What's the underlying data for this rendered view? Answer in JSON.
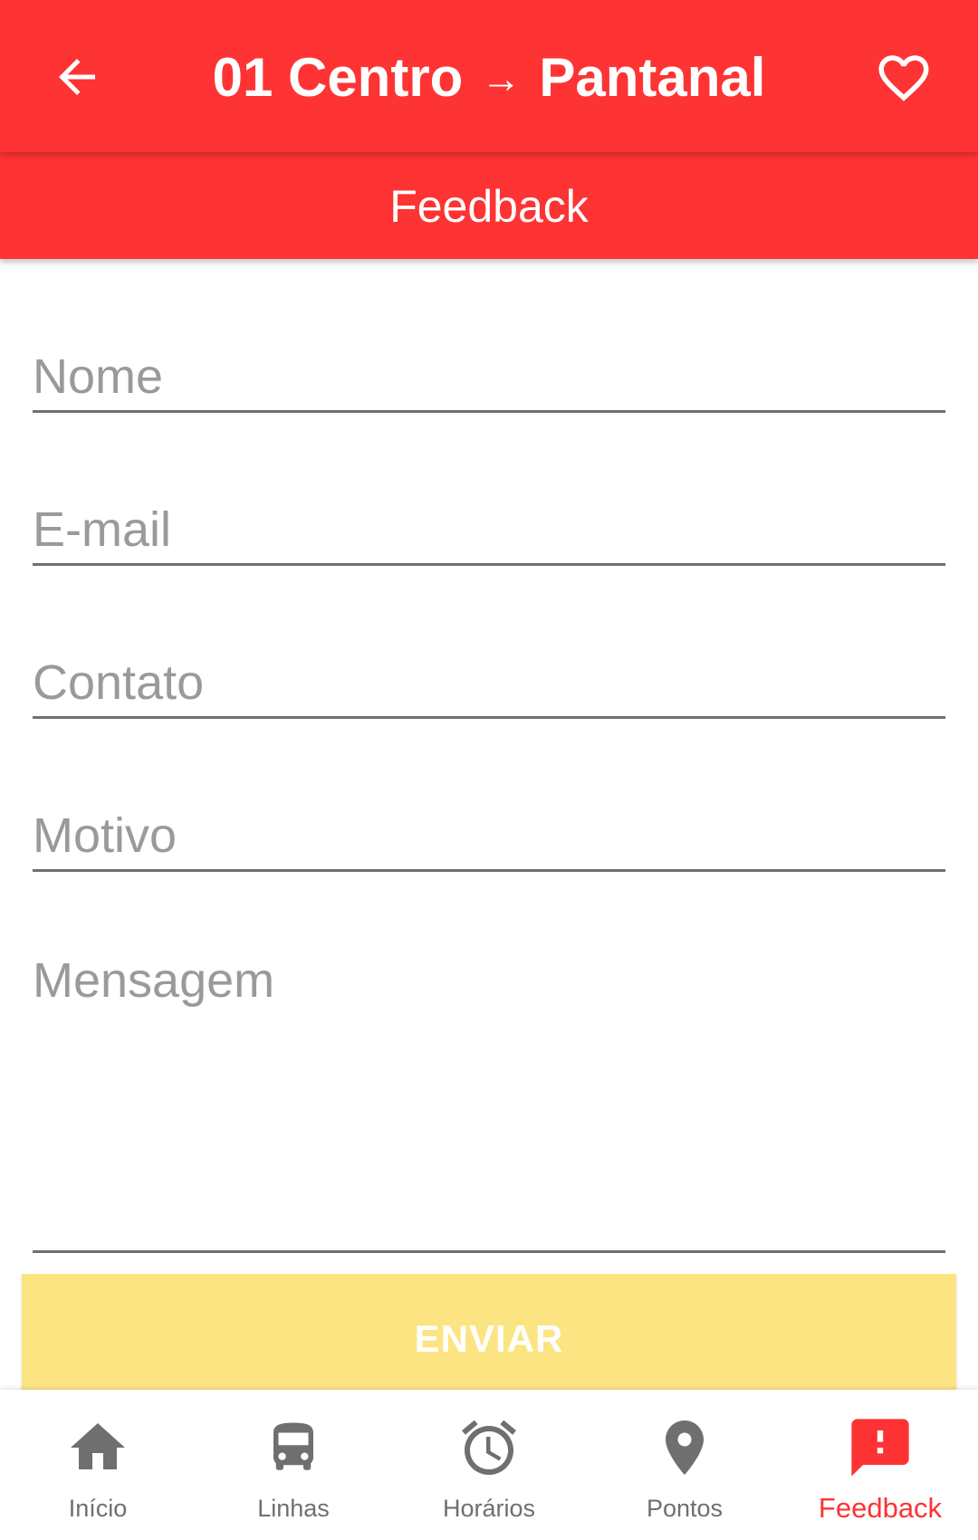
{
  "app_bar": {
    "title_from": "01 Centro",
    "title_arrow": "→",
    "title_to": "Pantanal",
    "back_icon": "arrow-left-icon",
    "favorite_icon": "heart-outline-icon",
    "color": "#fe3333"
  },
  "sub_header": {
    "title": "Feedback"
  },
  "form": {
    "name_placeholder": "Nome",
    "email_placeholder": "E-mail",
    "contact_placeholder": "Contato",
    "reason_placeholder": "Motivo",
    "message_placeholder": "Mensagem",
    "submit_label": "ENVIAR",
    "submit_color": "#fce483"
  },
  "bottom_nav": {
    "items": [
      {
        "label": "Início",
        "icon": "home-icon"
      },
      {
        "label": "Linhas",
        "icon": "bus-icon"
      },
      {
        "label": "Horários",
        "icon": "alarm-clock-icon"
      },
      {
        "label": "Pontos",
        "icon": "map-pin-icon"
      },
      {
        "label": "Feedback",
        "icon": "feedback-icon"
      }
    ],
    "active_label": "Feedback",
    "active_color": "#fe3333",
    "inactive_color": "#6f6f6f"
  }
}
